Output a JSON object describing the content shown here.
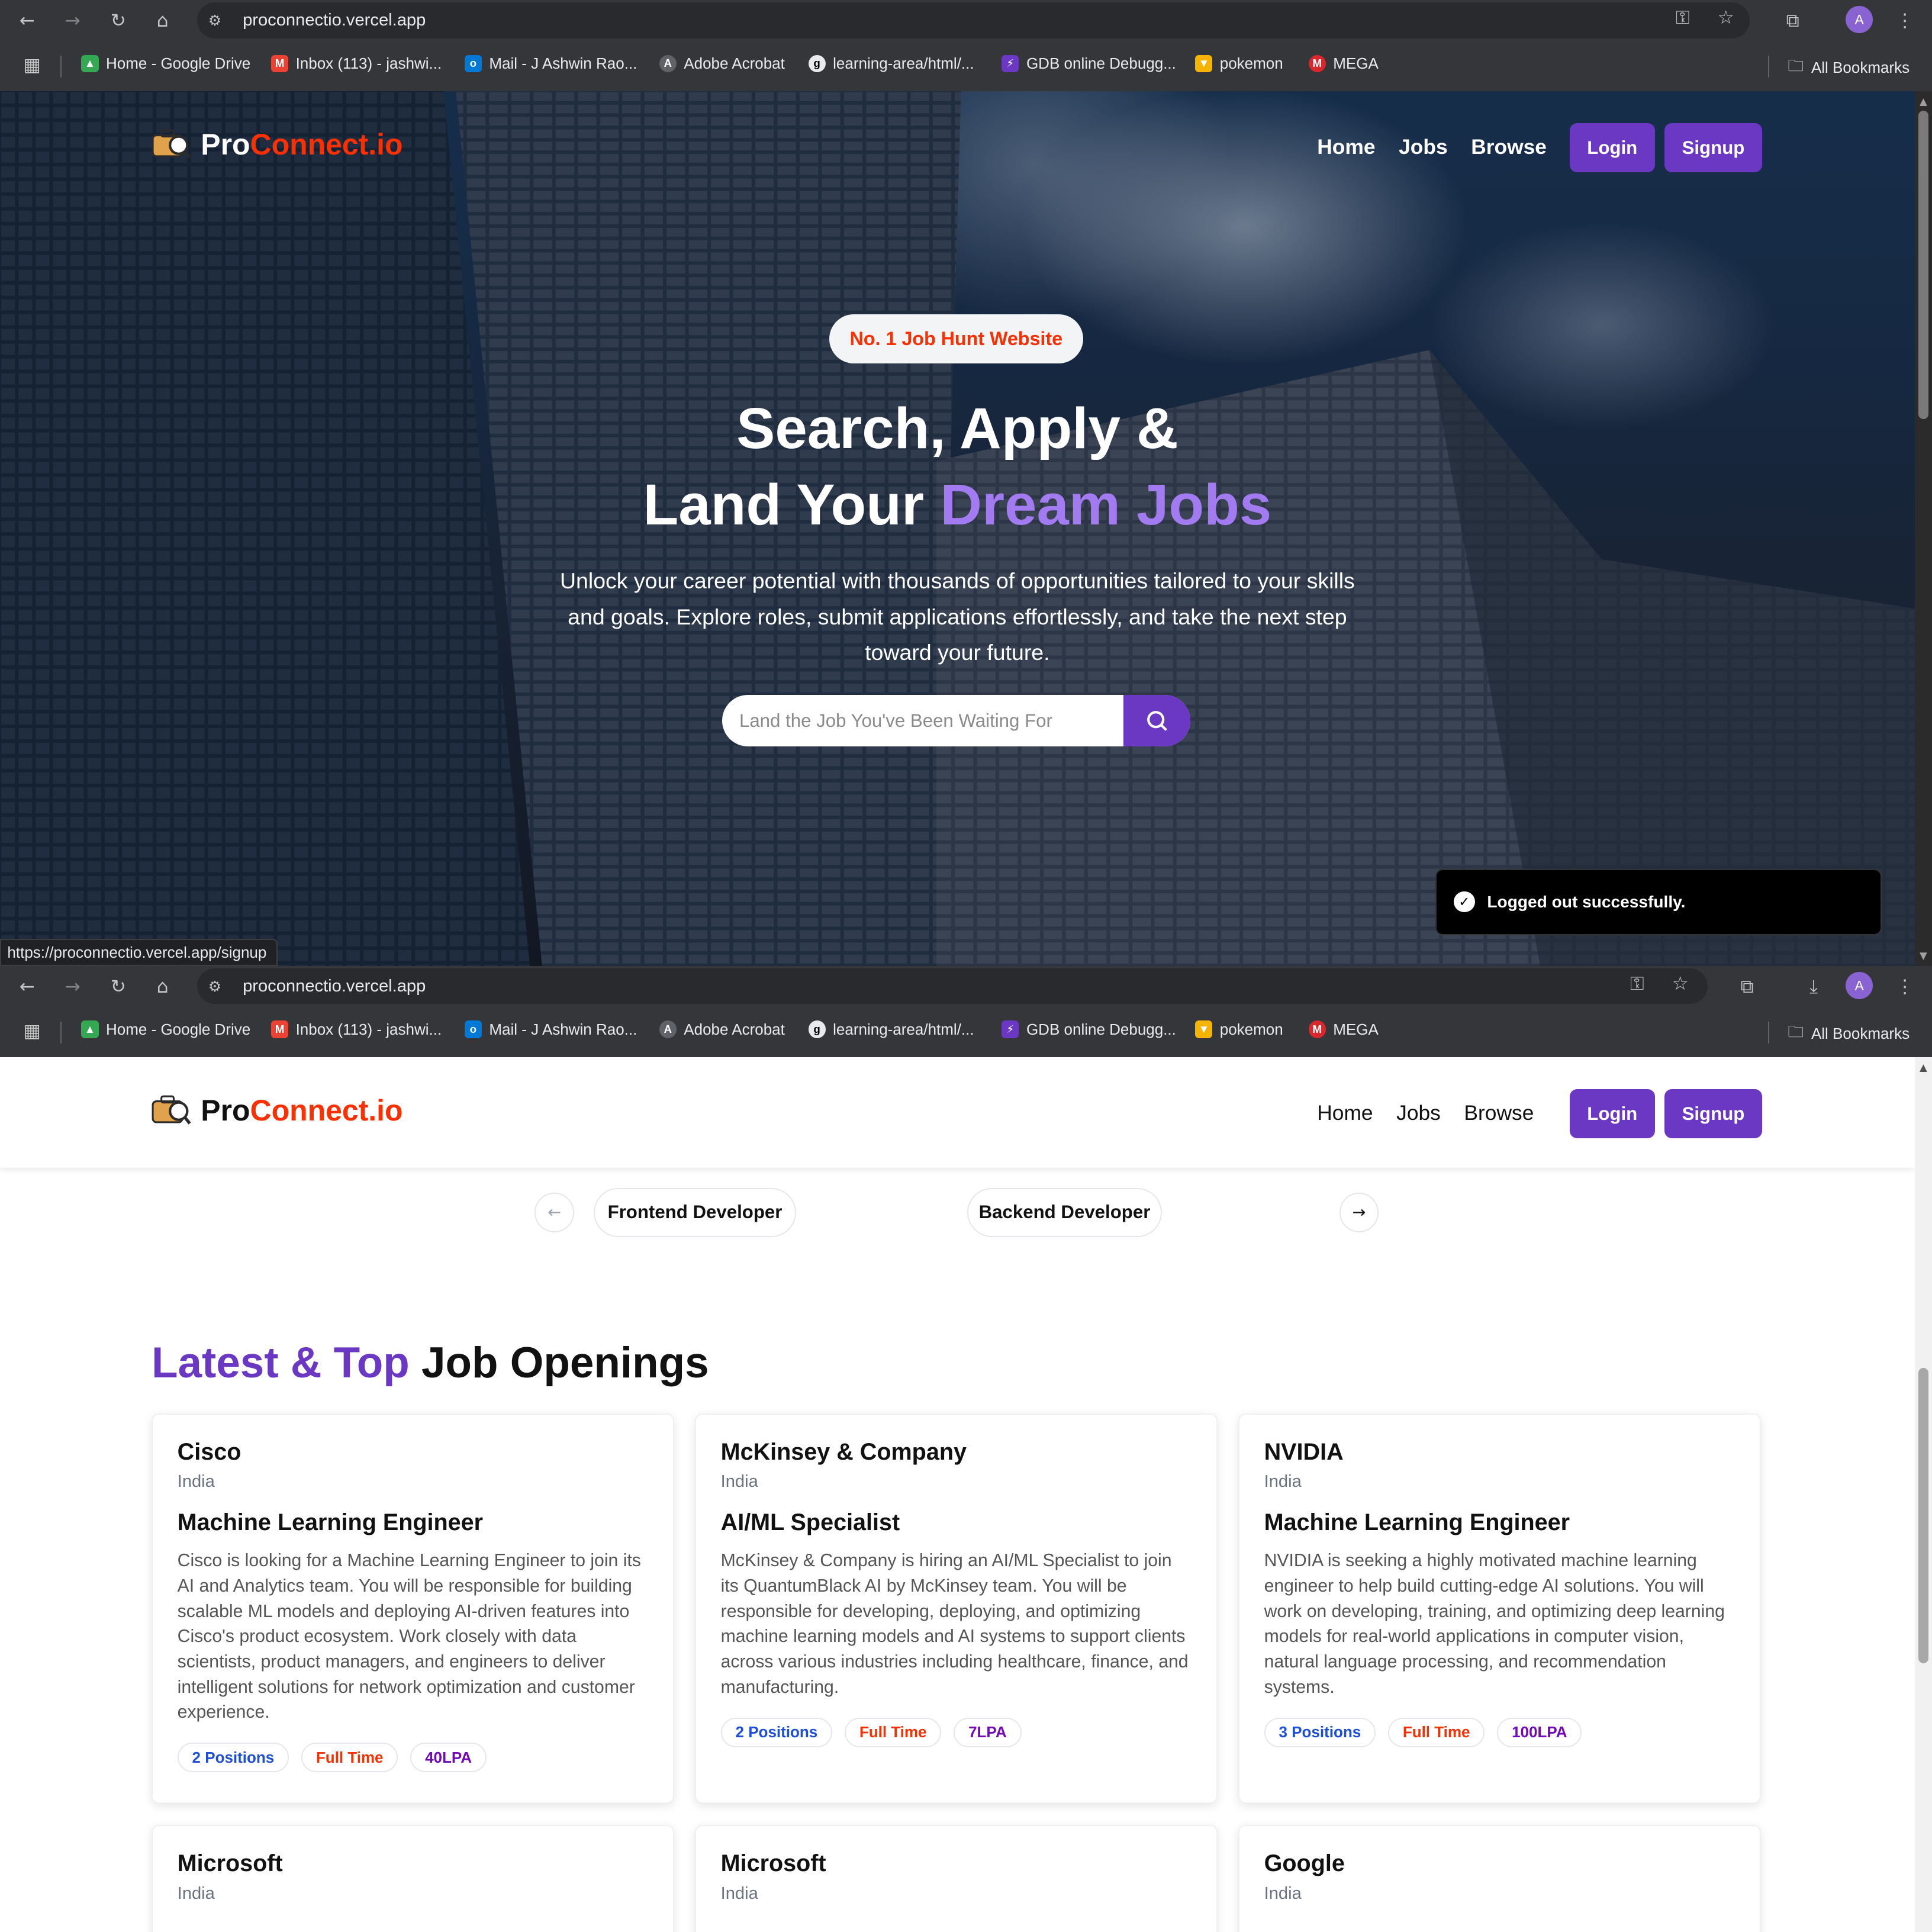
{
  "browser": {
    "url": "proconnectio.vercel.app",
    "profile_initial": "A",
    "bookmarks": [
      {
        "label": "Home - Google Drive",
        "icon": "google-drive-icon",
        "color": "#34a853"
      },
      {
        "label": "Inbox (113) - jashwi...",
        "icon": "gmail-icon",
        "color": "#ea4335"
      },
      {
        "label": "Mail - J Ashwin Rao...",
        "icon": "outlook-icon",
        "color": "#0078d4"
      },
      {
        "label": "Adobe Acrobat",
        "icon": "acrobat-icon",
        "color": "#9aa0a6"
      },
      {
        "label": "learning-area/html/...",
        "icon": "github-icon",
        "color": "#e8eaed"
      },
      {
        "label": "GDB online Debugg...",
        "icon": "gdb-icon",
        "color": "#6a38c2"
      },
      {
        "label": "pokemon",
        "icon": "pokemon-icon",
        "color": "#f4b400"
      },
      {
        "label": "MEGA",
        "icon": "mega-icon",
        "color": "#d9272e"
      }
    ],
    "all_bookmarks": "All Bookmarks",
    "status_url": "https://proconnectio.vercel.app/signup"
  },
  "site": {
    "logo_pro": "Pro",
    "logo_connect": "Connect.io",
    "nav": [
      "Home",
      "Jobs",
      "Browse"
    ],
    "login": "Login",
    "signup": "Signup"
  },
  "hero": {
    "badge": "No. 1 Job Hunt Website",
    "title_line1": "Search, Apply &",
    "title_line2_prefix": "Land Your ",
    "title_line2_accent": "Dream Jobs",
    "subtitle": "Unlock your career potential with thousands of opportunities tailored to your skills and goals. Explore roles, submit applications effortlessly, and take the next step toward your future.",
    "search_placeholder": "Land the Job You've Been Waiting For"
  },
  "toast": {
    "message": "Logged out successfully."
  },
  "categories": [
    "Frontend Developer",
    "Backend Developer"
  ],
  "section": {
    "title_accent": "Latest & Top",
    "title_rest": " Job Openings"
  },
  "jobs": [
    {
      "company": "Cisco",
      "location": "India",
      "role": "Machine Learning Engineer",
      "description": "Cisco is looking for a Machine Learning Engineer to join its AI and Analytics team. You will be responsible for building scalable ML models and deploying AI-driven features into Cisco's product ecosystem. Work closely with data scientists, product managers, and engineers to deliver intelligent solutions for network optimization and customer experience.",
      "positions": "2 Positions",
      "type": "Full Time",
      "salary": "40LPA"
    },
    {
      "company": "McKinsey & Company",
      "location": "India",
      "role": "AI/ML Specialist",
      "description": "McKinsey & Company is hiring an AI/ML Specialist to join its QuantumBlack AI by McKinsey team. You will be responsible for developing, deploying, and optimizing machine learning models and AI systems to support clients across various industries including healthcare, finance, and manufacturing.",
      "positions": "2 Positions",
      "type": "Full Time",
      "salary": "7LPA"
    },
    {
      "company": "NVIDIA",
      "location": "India",
      "role": "Machine Learning Engineer",
      "description": "NVIDIA is seeking a highly motivated machine learning engineer to help build cutting-edge AI solutions. You will work on developing, training, and optimizing deep learning models for real-world applications in computer vision, natural language processing, and recommendation systems.",
      "positions": "3 Positions",
      "type": "Full Time",
      "salary": "100LPA"
    },
    {
      "company": "Microsoft",
      "location": "India"
    },
    {
      "company": "Microsoft",
      "location": "India"
    },
    {
      "company": "Google",
      "location": "India"
    }
  ]
}
